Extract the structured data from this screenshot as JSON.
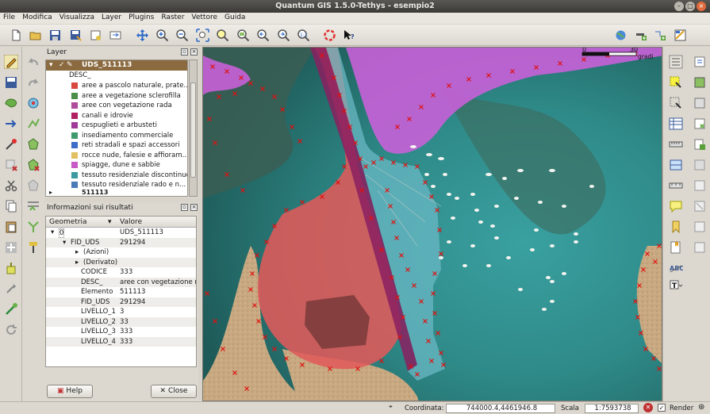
{
  "window": {
    "title": "Quantum GIS 1.5.0-Tethys - esempio2"
  },
  "menu": [
    "File",
    "Modifica",
    "Visualizza",
    "Layer",
    "Plugins",
    "Raster",
    "Vettore",
    "Guida"
  ],
  "toolbar_icons": [
    "new-project-icon",
    "open-project-icon",
    "save-project-icon",
    "save-as-icon",
    "print-composer-icon",
    "composer-manager-icon",
    "pan-icon",
    "zoom-in-icon",
    "zoom-out-icon",
    "zoom-full-icon",
    "zoom-selection-icon",
    "zoom-layer-icon",
    "zoom-last-icon",
    "zoom-next-icon",
    "refresh-icon",
    "whats-this-icon"
  ],
  "layer_panel": {
    "title": "Layer",
    "layer_name": "UDS_511113",
    "field_label": "DESC_",
    "categories": [
      {
        "label": "aree a pascolo naturale, prate...",
        "color": "#d8483e"
      },
      {
        "label": "aree a vegetazione sclerofilla",
        "color": "#4a8e4a"
      },
      {
        "label": "aree con vegetazione rada",
        "color": "#b04a9a"
      },
      {
        "label": "canali e idrovie",
        "color": "#b02060"
      },
      {
        "label": "cespuglieti e arbusteti",
        "color": "#a0389a"
      },
      {
        "label": "insediamento commerciale",
        "color": "#3e9a6e"
      },
      {
        "label": "reti stradali e spazi accessori",
        "color": "#3a6ec8"
      },
      {
        "label": "rocce nude, falesie e affioram...",
        "color": "#e0c060"
      },
      {
        "label": "spiagge, dune e sabbie",
        "color": "#c85ac8"
      },
      {
        "label": "tessuto residenziale discontinuo",
        "color": "#3a9aa0"
      },
      {
        "label": "tessuto residenziale rado e n...",
        "color": "#4a7ab8"
      }
    ],
    "second_layer": "511113"
  },
  "info_panel": {
    "title": "Informazioni sui risultati",
    "col_geometry": "Geometria",
    "col_value": "Valore",
    "rows": [
      {
        "key": "0",
        "value": "UDS_511113",
        "indent": 1,
        "arrow": "▾"
      },
      {
        "key": "FID_UDS",
        "value": "291294",
        "indent": 2,
        "arrow": "▾"
      },
      {
        "key": "(Azioni)",
        "value": "",
        "indent": 3,
        "arrow": "▸"
      },
      {
        "key": "(Derivato)",
        "value": "",
        "indent": 3,
        "arrow": "▸"
      },
      {
        "key": "CODICE",
        "value": "333",
        "indent": 4,
        "arrow": ""
      },
      {
        "key": "DESC_",
        "value": "aree con vegetazione r",
        "indent": 4,
        "arrow": ""
      },
      {
        "key": "Elemento",
        "value": "511113",
        "indent": 4,
        "arrow": ""
      },
      {
        "key": "FID_UDS",
        "value": "291294",
        "indent": 4,
        "arrow": ""
      },
      {
        "key": "LIVELLO_1",
        "value": "3",
        "indent": 4,
        "arrow": ""
      },
      {
        "key": "LIVELLO_2",
        "value": "33",
        "indent": 4,
        "arrow": ""
      },
      {
        "key": "LIVELLO_3",
        "value": "333",
        "indent": 4,
        "arrow": ""
      },
      {
        "key": "LIVELLO_4",
        "value": "333",
        "indent": 4,
        "arrow": ""
      }
    ],
    "help_label": "Help",
    "close_label": "Close"
  },
  "map": {
    "scalebar_start": "0",
    "scalebar_end": "30",
    "scalebar_unit": "gradi"
  },
  "status": {
    "coord_label": "Coordinata:",
    "coord_value": "744000.4,4461946.8",
    "scale_label": "Scala",
    "scale_value": "1:7593738",
    "render_label": "Render"
  },
  "colors": {
    "selected_layer": "#8a6a3e",
    "polygon_red": "#e05a5a",
    "polygon_teal": "#6ab8c4",
    "polygon_purple": "#c860d8",
    "polygon_tan": "#d8b88a",
    "vertex_marker": "#e01010"
  }
}
